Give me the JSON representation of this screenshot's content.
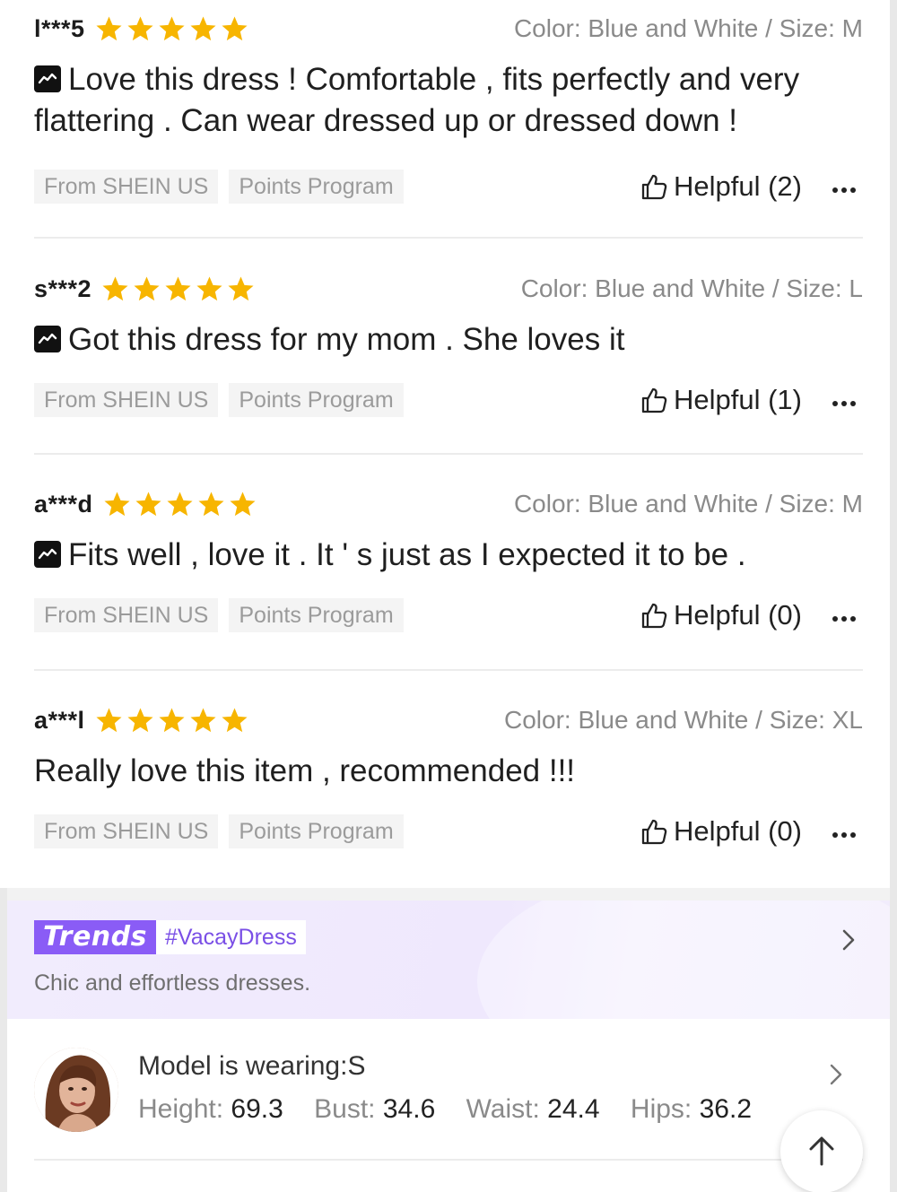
{
  "reviews": [
    {
      "user": "l***5",
      "rating": 5,
      "meta": "Color: Blue and White / Size: M",
      "translated": true,
      "text": "Love this dress ! Comfortable , fits perfectly and very flattering . Can wear dressed up or dressed down !",
      "tags": [
        "From SHEIN US",
        "Points Program"
      ],
      "helpful": "Helpful (2)"
    },
    {
      "user": "s***2",
      "rating": 5,
      "meta": "Color: Blue and White / Size: L",
      "translated": true,
      "text": "Got this dress for my mom . She loves it",
      "tags": [
        "From SHEIN US",
        "Points Program"
      ],
      "helpful": "Helpful (1)"
    },
    {
      "user": "a***d",
      "rating": 5,
      "meta": "Color: Blue and White / Size: M",
      "translated": true,
      "text": "Fits well , love it . It ' s just as I expected it to be .",
      "tags": [
        "From SHEIN US",
        "Points Program"
      ],
      "helpful": "Helpful (0)"
    },
    {
      "user": "a***l",
      "rating": 5,
      "meta": "Color: Blue and White / Size: XL",
      "translated": false,
      "text": "Really love this item , recommended !!!",
      "tags": [
        "From SHEIN US",
        "Points Program"
      ],
      "helpful": "Helpful (0)"
    }
  ],
  "trends": {
    "logo": "Trends",
    "hashtag": "#VacayDress",
    "description": "Chic and effortless dresses."
  },
  "model": {
    "title": "Model is wearing:S",
    "stats": [
      {
        "label": "Height:",
        "value": "69.3"
      },
      {
        "label": "Bust:",
        "value": "34.6"
      },
      {
        "label": "Waist:",
        "value": "24.4"
      },
      {
        "label": "Hips:",
        "value": "36.2"
      }
    ]
  },
  "colors": {
    "star": "#f7b500",
    "trends_accent": "#8a5cf6",
    "trends_bg": "#f1ecfd"
  },
  "icons": {
    "star": "star-icon",
    "translate": "translate-icon",
    "helpful": "thumbs-up-icon",
    "more": "more-dots-icon",
    "chevron": "chevron-right-icon",
    "back_to_top": "arrow-up-icon"
  }
}
